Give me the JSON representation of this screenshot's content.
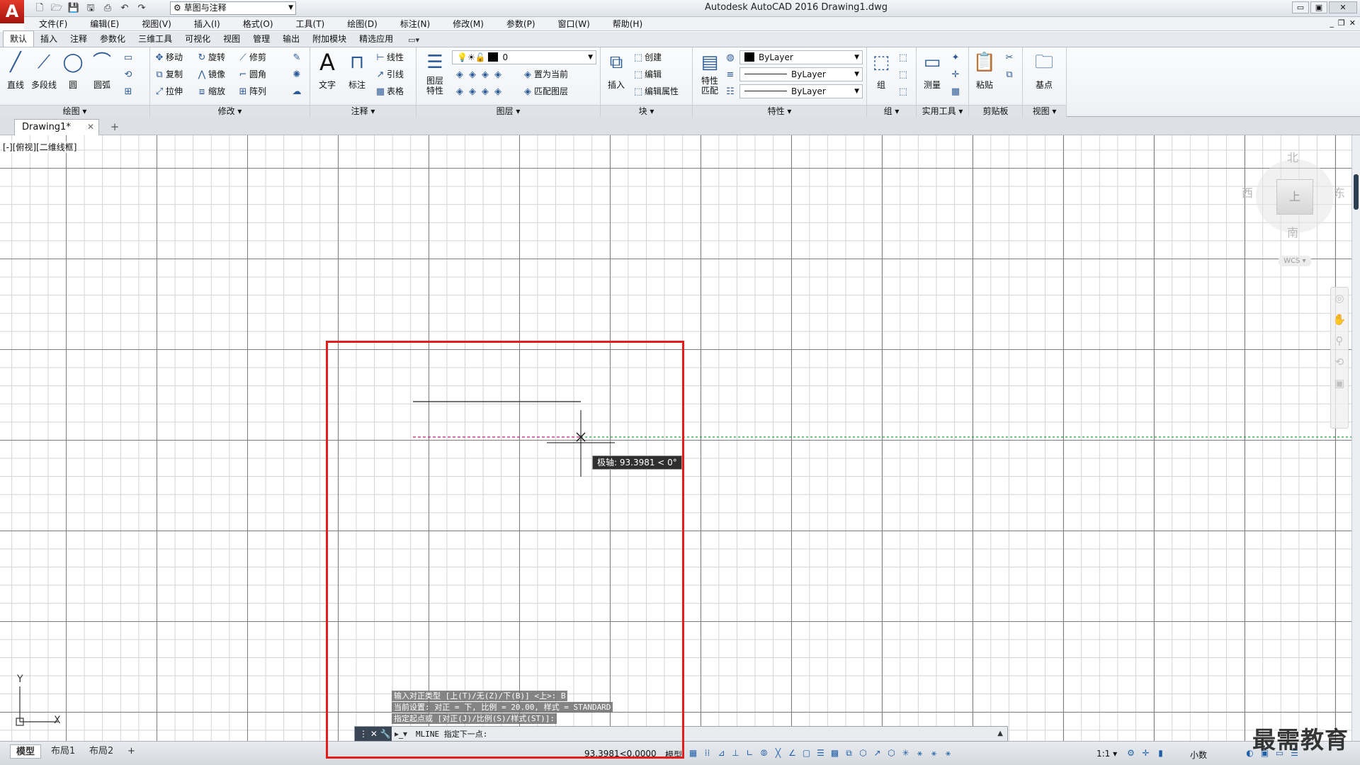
{
  "window": {
    "title": "Autodesk AutoCAD 2016    Drawing1.dwg",
    "logo": "A",
    "workspace": "草图与注释",
    "min": "▭",
    "max": "▣",
    "close": "✕"
  },
  "menu": [
    "文件(F)",
    "编辑(E)",
    "视图(V)",
    "插入(I)",
    "格式(O)",
    "工具(T)",
    "绘图(D)",
    "标注(N)",
    "修改(M)",
    "参数(P)",
    "窗口(W)",
    "帮助(H)"
  ],
  "ribbon_tabs": [
    "默认",
    "插入",
    "注释",
    "参数化",
    "三维工具",
    "可视化",
    "视图",
    "管理",
    "输出",
    "附加模块",
    "精选应用"
  ],
  "ribbon_extra": "▭▾",
  "panels": {
    "draw": {
      "title": "绘图 ▾",
      "line": "直线",
      "polyline": "多段线",
      "circle": "圆",
      "arc": "圆弧"
    },
    "modify": {
      "title": "修改 ▾",
      "move": "移动",
      "rotate": "旋转",
      "trim": "修剪",
      "copy": "复制",
      "mirror": "镜像",
      "fillet": "圆角",
      "stretch": "拉伸",
      "scale": "缩放",
      "array": "阵列"
    },
    "annotation": {
      "title": "注释 ▾",
      "text": "文字",
      "dimension": "标注",
      "linear": "线性",
      "leader": "引线",
      "table": "表格"
    },
    "layers": {
      "title": "图层 ▾",
      "props": "图层\n特性",
      "layer_value": "0",
      "set_current": "置为当前",
      "match_layer": "匹配图层"
    },
    "block": {
      "title": "块 ▾",
      "insert": "插入",
      "create": "创建",
      "edit": "编辑",
      "edit_attr": "编辑属性"
    },
    "properties": {
      "title": "特性 ▾",
      "match": "特性\n匹配",
      "color": "ByLayer",
      "linetype": "ByLayer",
      "lineweight": "ByLayer"
    },
    "groups": {
      "title": "组 ▾",
      "group": "组"
    },
    "utilities": {
      "title": "实用工具 ▾",
      "measure": "测量"
    },
    "clipboard": {
      "title": "剪贴板",
      "paste": "粘贴"
    },
    "view": {
      "title": "视图 ▾",
      "base": "基点"
    }
  },
  "file_tab": {
    "name": "Drawing1*",
    "close": "✕",
    "new": "+"
  },
  "viewport_label": "[-][俯视][二维线框]",
  "viewcube": {
    "north": "北",
    "south": "南",
    "east": "东",
    "west": "西",
    "face": "上",
    "wcs": "WCS ▾"
  },
  "ucs": {
    "x": "X",
    "y": "Y"
  },
  "tooltip": "极轴: 93.3981 < 0°",
  "command_history": [
    "输入对正类型 [上(T)/无(Z)/下(B)] <上>: B",
    "当前设置: 对正 = 下, 比例 = 20.00, 样式 = STANDARD",
    "指定起点或 [对正(J)/比例(S)/样式(ST)]:"
  ],
  "command_bar": {
    "grip": "⋮ ✕ 🔧",
    "prompt_icon": "▸_▾",
    "input_value": "MLINE 指定下一点:",
    "expand": "▲"
  },
  "status": {
    "tabs": [
      "模型",
      "布局1",
      "布局2"
    ],
    "add_tab": "+",
    "coords": "93.3981<0.0000",
    "space": "模型",
    "scale": "1:1 ▾",
    "units": "小数"
  },
  "watermark": "最需教育",
  "colors": {
    "highlight": "#e61c1c",
    "polar_track": "#1aa53a",
    "mline_preview": "#c2187a"
  }
}
